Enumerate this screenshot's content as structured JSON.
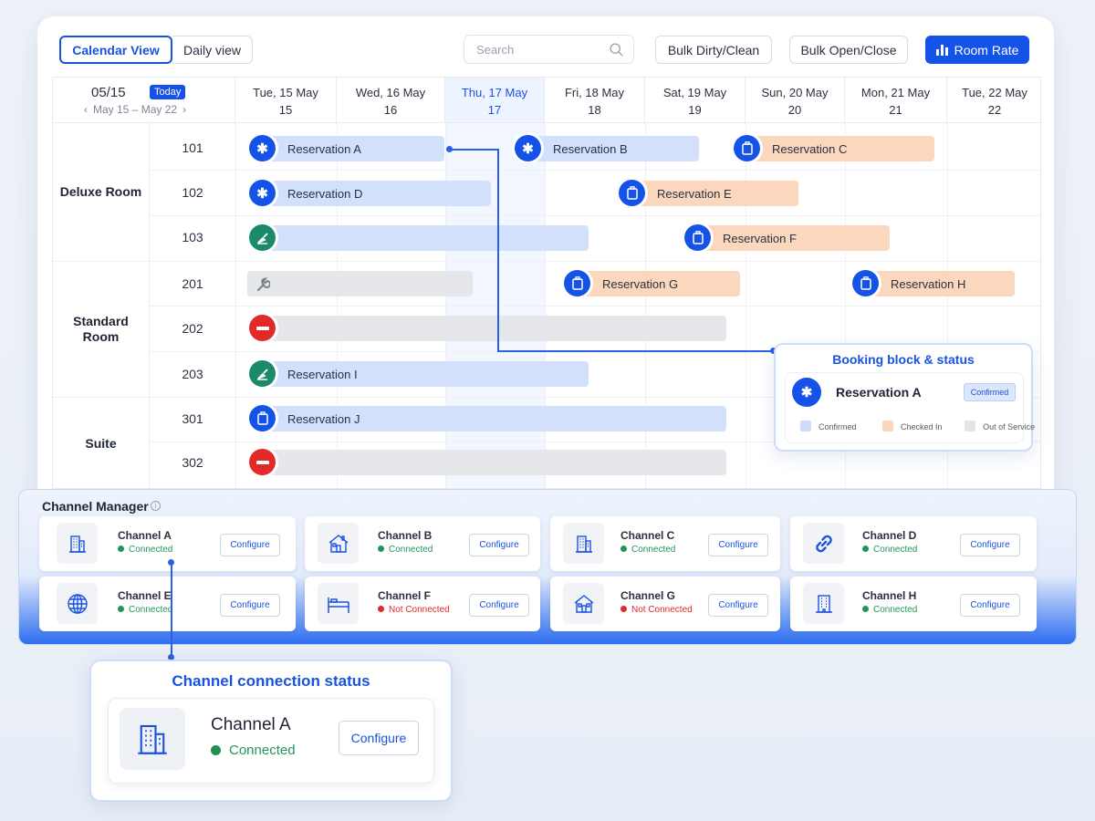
{
  "toolbar": {
    "calendar_view": "Calendar View",
    "daily_view": "Daily view",
    "search_placeholder": "Search",
    "bulk_dirty_clean": "Bulk Dirty/Clean",
    "bulk_open_close": "Bulk Open/Close",
    "room_rate": "Room Rate"
  },
  "calendar": {
    "current_date": "05/15",
    "today_badge": "Today",
    "range": "May 15 – May 22",
    "days": [
      {
        "label": "Tue, 15 May",
        "num": "15"
      },
      {
        "label": "Wed, 16 May",
        "num": "16"
      },
      {
        "label": "Thu, 17 May",
        "num": "17"
      },
      {
        "label": "Fri, 18 May",
        "num": "18"
      },
      {
        "label": "Sat, 19 May",
        "num": "19"
      },
      {
        "label": "Sun, 20 May",
        "num": "20"
      },
      {
        "label": "Mon, 21 May",
        "num": "21"
      },
      {
        "label": "Tue, 22 May",
        "num": "22"
      }
    ],
    "room_types": [
      "Deluxe Room",
      "Standard Room",
      "Suite"
    ],
    "rooms": [
      "101",
      "102",
      "103",
      "201",
      "202",
      "203",
      "301",
      "302"
    ],
    "reservations": {
      "a": "Reservation A",
      "b": "Reservation B",
      "c": "Reservation C",
      "d": "Reservation D",
      "e": "Reservation E",
      "f": "Reservation F",
      "g": "Reservation G",
      "h": "Reservation H",
      "i": "Reservation I",
      "j": "Reservation J"
    }
  },
  "booking_popover": {
    "title": "Booking block & status",
    "reservation": "Reservation A",
    "status": "Confirmed",
    "legend": [
      "Confirmed",
      "Checked In",
      "Out of Service"
    ],
    "colors": {
      "confirmed": "#cfdcf8",
      "checked_in": "#fbd6bb",
      "out_of_service": "#e3e4e7"
    }
  },
  "channel_manager": {
    "title": "Channel Manager",
    "configure_label": "Configure",
    "channels": [
      {
        "name": "Channel A",
        "status": "Connected",
        "icon": "building-icon"
      },
      {
        "name": "Channel B",
        "status": "Connected",
        "icon": "house-icon"
      },
      {
        "name": "Channel C",
        "status": "Connected",
        "icon": "building-icon"
      },
      {
        "name": "Channel D",
        "status": "Connected",
        "icon": "link-icon"
      },
      {
        "name": "Channel E",
        "status": "Connected",
        "icon": "globe-icon"
      },
      {
        "name": "Channel F",
        "status": "Not Connected",
        "icon": "bed-icon"
      },
      {
        "name": "Channel G",
        "status": "Not Connected",
        "icon": "house-icon"
      },
      {
        "name": "Channel H",
        "status": "Connected",
        "icon": "building-icon"
      }
    ]
  },
  "channel_status_card": {
    "title": "Channel connection status",
    "name": "Channel A",
    "status": "Connected",
    "configure": "Configure"
  },
  "colors": {
    "accent": "#1553e8",
    "connected": "#23955b",
    "not_connected": "#e02a2a"
  }
}
